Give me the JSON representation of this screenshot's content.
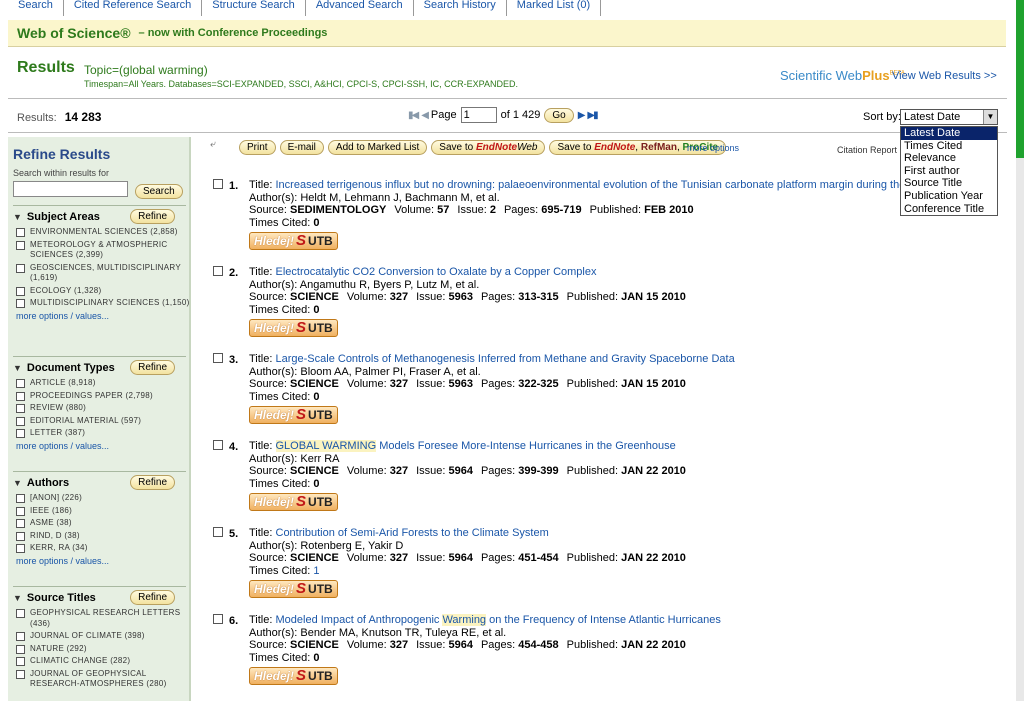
{
  "nav": {
    "tabs": [
      "Search",
      "Cited Reference Search",
      "Structure Search",
      "Advanced Search",
      "Search History",
      "Marked List (0)"
    ]
  },
  "banner": {
    "title": "Web of Science®",
    "tagline": "– now with Conference Proceedings"
  },
  "results": {
    "heading": "Results",
    "topic": "Topic=(global warming)",
    "timespan": "Timespan=All Years. Databases=SCI-EXPANDED, SSCI, A&HCI, CPCI-S, CPCI-SSH, IC, CCR-EXPANDED.",
    "webplus_logo": "Scientific WebPlus",
    "webplus_brand_a": "Scientific Web",
    "webplus_brand_b": "Plus",
    "webplus_beta": "BETA",
    "view_web_results": "View Web Results >>",
    "count_label": "Results:",
    "count_value": "14 283"
  },
  "pager": {
    "page_label": "Page",
    "page_value": "1",
    "of_label": "of 1 429",
    "go_label": "Go"
  },
  "sort": {
    "label": "Sort by:",
    "selected": "Latest Date",
    "options": [
      "Latest Date",
      "Times Cited",
      "Relevance",
      "First author",
      "Source Title",
      "Publication Year",
      "Conference Title"
    ]
  },
  "sidebar": {
    "title": "Refine Results",
    "search_within_label": "Search within results for",
    "search_button": "Search",
    "refine_label": "Refine",
    "sections": [
      {
        "title": "Subject Areas",
        "items": [
          "ENVIRONMENTAL SCIENCES (2,858)",
          "METEOROLOGY & ATMOSPHERIC SCIENCES (2,399)",
          "GEOSCIENCES, MULTIDISCIPLINARY (1,619)",
          "ECOLOGY (1,328)",
          "MULTIDISCIPLINARY SCIENCES (1,150)"
        ],
        "more": "more options / values..."
      },
      {
        "title": "Document Types",
        "items": [
          "ARTICLE (8,918)",
          "PROCEEDINGS PAPER (2,798)",
          "REVIEW (880)",
          "EDITORIAL MATERIAL (597)",
          "LETTER (387)"
        ],
        "more": "more options / values..."
      },
      {
        "title": "Authors",
        "items": [
          "[ANON] (226)",
          "IEEE (186)",
          "ASME (38)",
          "RIND, D (38)",
          "KERR, RA (34)"
        ],
        "more": "more options / values..."
      },
      {
        "title": "Source Titles",
        "items": [
          "GEOPHYSICAL RESEARCH LETTERS (436)",
          "JOURNAL OF CLIMATE (398)",
          "NATURE (292)",
          "CLIMATIC CHANGE (282)",
          "JOURNAL OF GEOPHYSICAL RESEARCH-ATMOSPHERES (280)"
        ],
        "more": ""
      }
    ]
  },
  "actions": {
    "print": "Print",
    "email": "E-mail",
    "add_marked": "Add to Marked List",
    "save_endnote_web_a": "Save to ",
    "save_endnote_web_b": "EndNote",
    "save_endnote_web_c": "Web",
    "save_endnote_a": "Save to ",
    "save_endnote_b": "EndNote",
    "save_endnote_c": "RefMan",
    "save_endnote_d": "ProCite",
    "more_options": "more options",
    "citation_report": "Citation Report"
  },
  "labels": {
    "title": "Title:",
    "authors": "Author(s):",
    "source": "Source:",
    "volume": "Volume:",
    "issue": "Issue:",
    "pages": "Pages:",
    "published": "Published:",
    "times_cited": "Times Cited:",
    "hledej": "Hledej!",
    "hledej_s": "S",
    "utb": "UTB"
  },
  "records": [
    {
      "num": "1.",
      "title_pre": "Increased terrigenous influx but no drowning: palaeoenvironmental evolution of the Tunisian carbonate platform margin during the L",
      "title_hl": "",
      "title_post": "",
      "authors": "Heldt M, Lehmann J, Bachmann M, et al.",
      "source": "SEDIMENTOLOGY",
      "volume": "57",
      "issue": "2",
      "pages": "695-719",
      "published": "FEB 2010",
      "times_cited": "0"
    },
    {
      "num": "2.",
      "title_pre": "Electrocatalytic CO2 Conversion to Oxalate by a Copper Complex",
      "title_hl": "",
      "title_post": "",
      "authors": "Angamuthu R, Byers P, Lutz M, et al.",
      "source": "SCIENCE",
      "volume": "327",
      "issue": "5963",
      "pages": "313-315",
      "published": "JAN 15 2010",
      "times_cited": "0"
    },
    {
      "num": "3.",
      "title_pre": "Large-Scale Controls of Methanogenesis Inferred from Methane and Gravity Spaceborne Data",
      "title_hl": "",
      "title_post": "",
      "authors": "Bloom AA, Palmer PI, Fraser A, et al.",
      "source": "SCIENCE",
      "volume": "327",
      "issue": "5963",
      "pages": "322-325",
      "published": "JAN 15 2010",
      "times_cited": "0"
    },
    {
      "num": "4.",
      "title_pre": "",
      "title_hl": "GLOBAL WARMING",
      "title_post": " Models Foresee More-Intense Hurricanes in the Greenhouse",
      "authors": "Kerr RA",
      "source": "SCIENCE",
      "volume": "327",
      "issue": "5964",
      "pages": "399-399",
      "published": "JAN 22 2010",
      "times_cited": "0"
    },
    {
      "num": "5.",
      "title_pre": "Contribution of Semi-Arid Forests to the Climate System",
      "title_hl": "",
      "title_post": "",
      "authors": "Rotenberg E, Yakir D",
      "source": "SCIENCE",
      "volume": "327",
      "issue": "5964",
      "pages": "451-454",
      "published": "JAN 22 2010",
      "times_cited": "1"
    },
    {
      "num": "6.",
      "title_pre": "Modeled Impact of Anthropogenic ",
      "title_hl": "Warming",
      "title_post": " on the Frequency of Intense Atlantic Hurricanes",
      "authors": "Bender MA, Knutson TR, Tuleya RE, et al.",
      "source": "SCIENCE",
      "volume": "327",
      "issue": "5964",
      "pages": "454-458",
      "published": "JAN 22 2010",
      "times_cited": "0"
    }
  ],
  "colors": {
    "green_text": "#2e7a1c",
    "link_blue": "#1a56a8",
    "banner_bg": "#fbf6cc",
    "sidebar_bg": "#e6efe2",
    "highlight_bg": "#fbf3c0",
    "sort_selected_bg": "#0a246a"
  }
}
